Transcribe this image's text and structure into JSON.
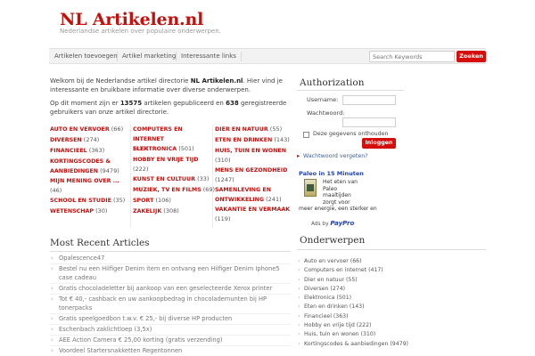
{
  "site": {
    "title": "NL Artikelen.nl",
    "description": "Nederlandse artikelen over populaire onderwerpen."
  },
  "nav": {
    "items": [
      "Artikelen toevoegen",
      "Artikel marketing",
      "Interessante links"
    ],
    "search_placeholder": "Search Keywords",
    "search_button": "Zoeken"
  },
  "intro": {
    "p1_pre": "Welkom bij de Nederlandse artikel directorie ",
    "p1_bold": "NL Artikelen.nl",
    "p1_post": ". Hier vind je interessante en bruikbare informatie over diverse onderwerpen.",
    "p2_pre": "Op dit moment zijn er ",
    "p2_articles": "13575",
    "p2_mid": " artikelen gepubliceerd en ",
    "p2_users": "638",
    "p2_post": " geregistreerde gebruikers van onze artikel directorie."
  },
  "categories": [
    [
      {
        "name": "AUTO EN VERVOER",
        "count": "(66)"
      },
      {
        "name": "DIVERSEN",
        "count": "(274)"
      },
      {
        "name": "FINANCIEEL",
        "count": "(363)"
      },
      {
        "name": "KORTINGSCODES & AANBIEDINGEN",
        "count": "(9479)"
      },
      {
        "name": "MIJN MENING OVER ...",
        "count": "(46)"
      },
      {
        "name": "SCHOOL EN STUDIE",
        "count": "(35)"
      },
      {
        "name": "WETENSCHAP",
        "count": "(30)"
      }
    ],
    [
      {
        "name": "COMPUTERS EN INTERNET",
        "count": "(417)"
      },
      {
        "name": "ELEKTRONICA",
        "count": "(501)"
      },
      {
        "name": "HOBBY EN VRIJE TIJD",
        "count": "(222)"
      },
      {
        "name": "KUNST EN CULTUUR",
        "count": "(33)"
      },
      {
        "name": "MUZIEK, TV EN FILMS",
        "count": "(69)"
      },
      {
        "name": "SPORT",
        "count": "(106)"
      },
      {
        "name": "ZAKELIJK",
        "count": "(308)"
      }
    ],
    [
      {
        "name": "DIER EN NATUUR",
        "count": "(55)"
      },
      {
        "name": "ETEN EN DRINKEN",
        "count": "(143)"
      },
      {
        "name": "HUIS, TUIN EN WONEN",
        "count": "(310)"
      },
      {
        "name": "MENS EN GEZONDHEID",
        "count": "(1247)"
      },
      {
        "name": "SAMENLEVING EN ONTWIKKELING",
        "count": "(241)"
      },
      {
        "name": "VAKANTIE EN VERMAAK",
        "count": "(119)"
      }
    ]
  ],
  "recent": {
    "title": "Most Recent Articles",
    "items": [
      "Opalescence47",
      "Bestel nu een Hilfiger Denim item en ontvang een Hilfiger Denim Iphone5 case cadeau",
      "Gratis chocoladeletter bij aankoop van een geselecteerde Xerox printer",
      "Tot € 40,- cashback en uw aankoopbedrag in chocolademunten bij HP tonerpacks",
      "Gratis speelgoedbon t.w.v. € 25,- bij diverse HP producten",
      "Eschenbach zaklichtloep (3,5x)",
      "AEE Action Camera € 25,00 korting (gratis verzending)",
      "Voordeel Startersnakketten Regentonnen"
    ]
  },
  "auth": {
    "title": "Authorization",
    "username_label": "Username:",
    "password_label": "Wachtwoord:",
    "remember_label": "Deze gegevens onthouden",
    "login_button": "Inloggen",
    "forgot_link": "Wachtwoord vergeten?"
  },
  "ad": {
    "title": "Paleo in 15 Minuten",
    "lines": [
      "Het eten van",
      "Paleo",
      "maaltijden",
      "zorgt voor"
    ],
    "line_full": "meer energie, een sterker en",
    "footer_pre": "Ads by",
    "footer_brand": "PayPro"
  },
  "topics": {
    "title": "Onderwerpen",
    "items": [
      "Auto en vervoer (66)",
      "Computers en internet (417)",
      "Dier en natuur (55)",
      "Diversen (274)",
      "Elektronica (501)",
      "Eten en drinken (143)",
      "Financieel (363)",
      "Hobby en vrije tijd (222)",
      "Huis, tuin en wonen (310)",
      "Kortingscodes & aanbiedingen (9479)"
    ]
  },
  "colors": {
    "brand_red": "#c3100c",
    "button_red": "#d40f0b",
    "link_blue": "#3a5e9c"
  }
}
